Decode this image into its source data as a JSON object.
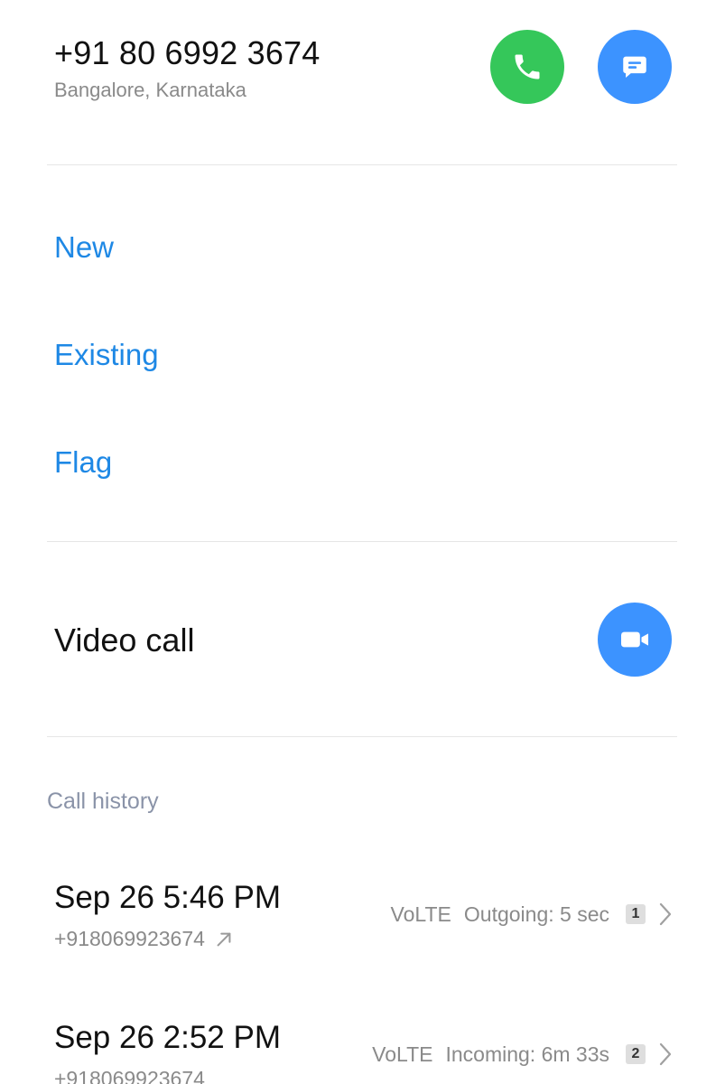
{
  "contact": {
    "number": "+91 80 6992 3674",
    "location": "Bangalore, Karnataka"
  },
  "actions": {
    "new_label": "New",
    "existing_label": "Existing",
    "flag_label": "Flag"
  },
  "video": {
    "label": "Video call"
  },
  "history": {
    "title": "Call history",
    "rows": [
      {
        "date": "Sep 26 5:46 PM",
        "number": "+918069923674",
        "tech": "VoLTE",
        "status": "Outgoing: 5 sec",
        "sim": "1"
      },
      {
        "date": "Sep 26 2:52 PM",
        "number": "+918069923674",
        "tech": "VoLTE",
        "status": "Incoming: 6m 33s",
        "sim": "2"
      }
    ]
  },
  "colors": {
    "call_green": "#35c75a",
    "accent_blue": "#3c93ff",
    "link_blue": "#1e88e5"
  },
  "icons": {
    "call": "phone-icon",
    "message": "message-icon",
    "video": "video-camera-icon",
    "outgoing": "outgoing-arrow-icon",
    "chevron": "chevron-right-icon"
  }
}
